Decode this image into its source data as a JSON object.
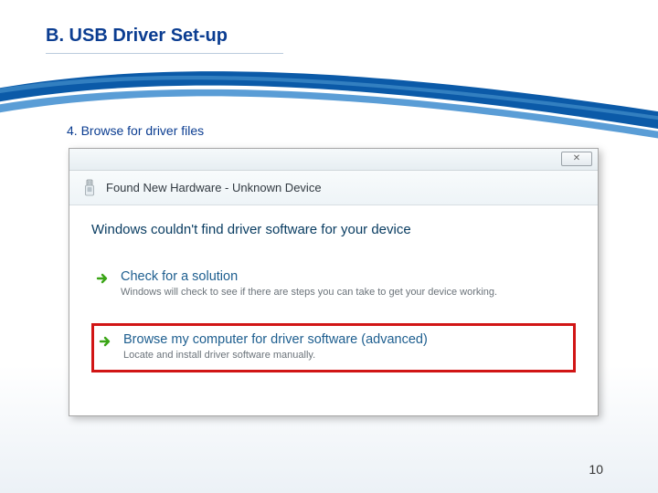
{
  "title": "B. USB Driver Set-up",
  "step": "4. Browse for driver files",
  "page_number": "10",
  "dialog": {
    "close_glyph": "✕",
    "header": "Found New Hardware - Unknown Device",
    "main_message": "Windows couldn't find driver software for your device",
    "option1": {
      "title": "Check for a solution",
      "sub": "Windows will check to see if there are steps you can take to get your device working."
    },
    "option2": {
      "title": "Browse my computer for driver software (advanced)",
      "sub": "Locate and install driver software manually."
    }
  }
}
